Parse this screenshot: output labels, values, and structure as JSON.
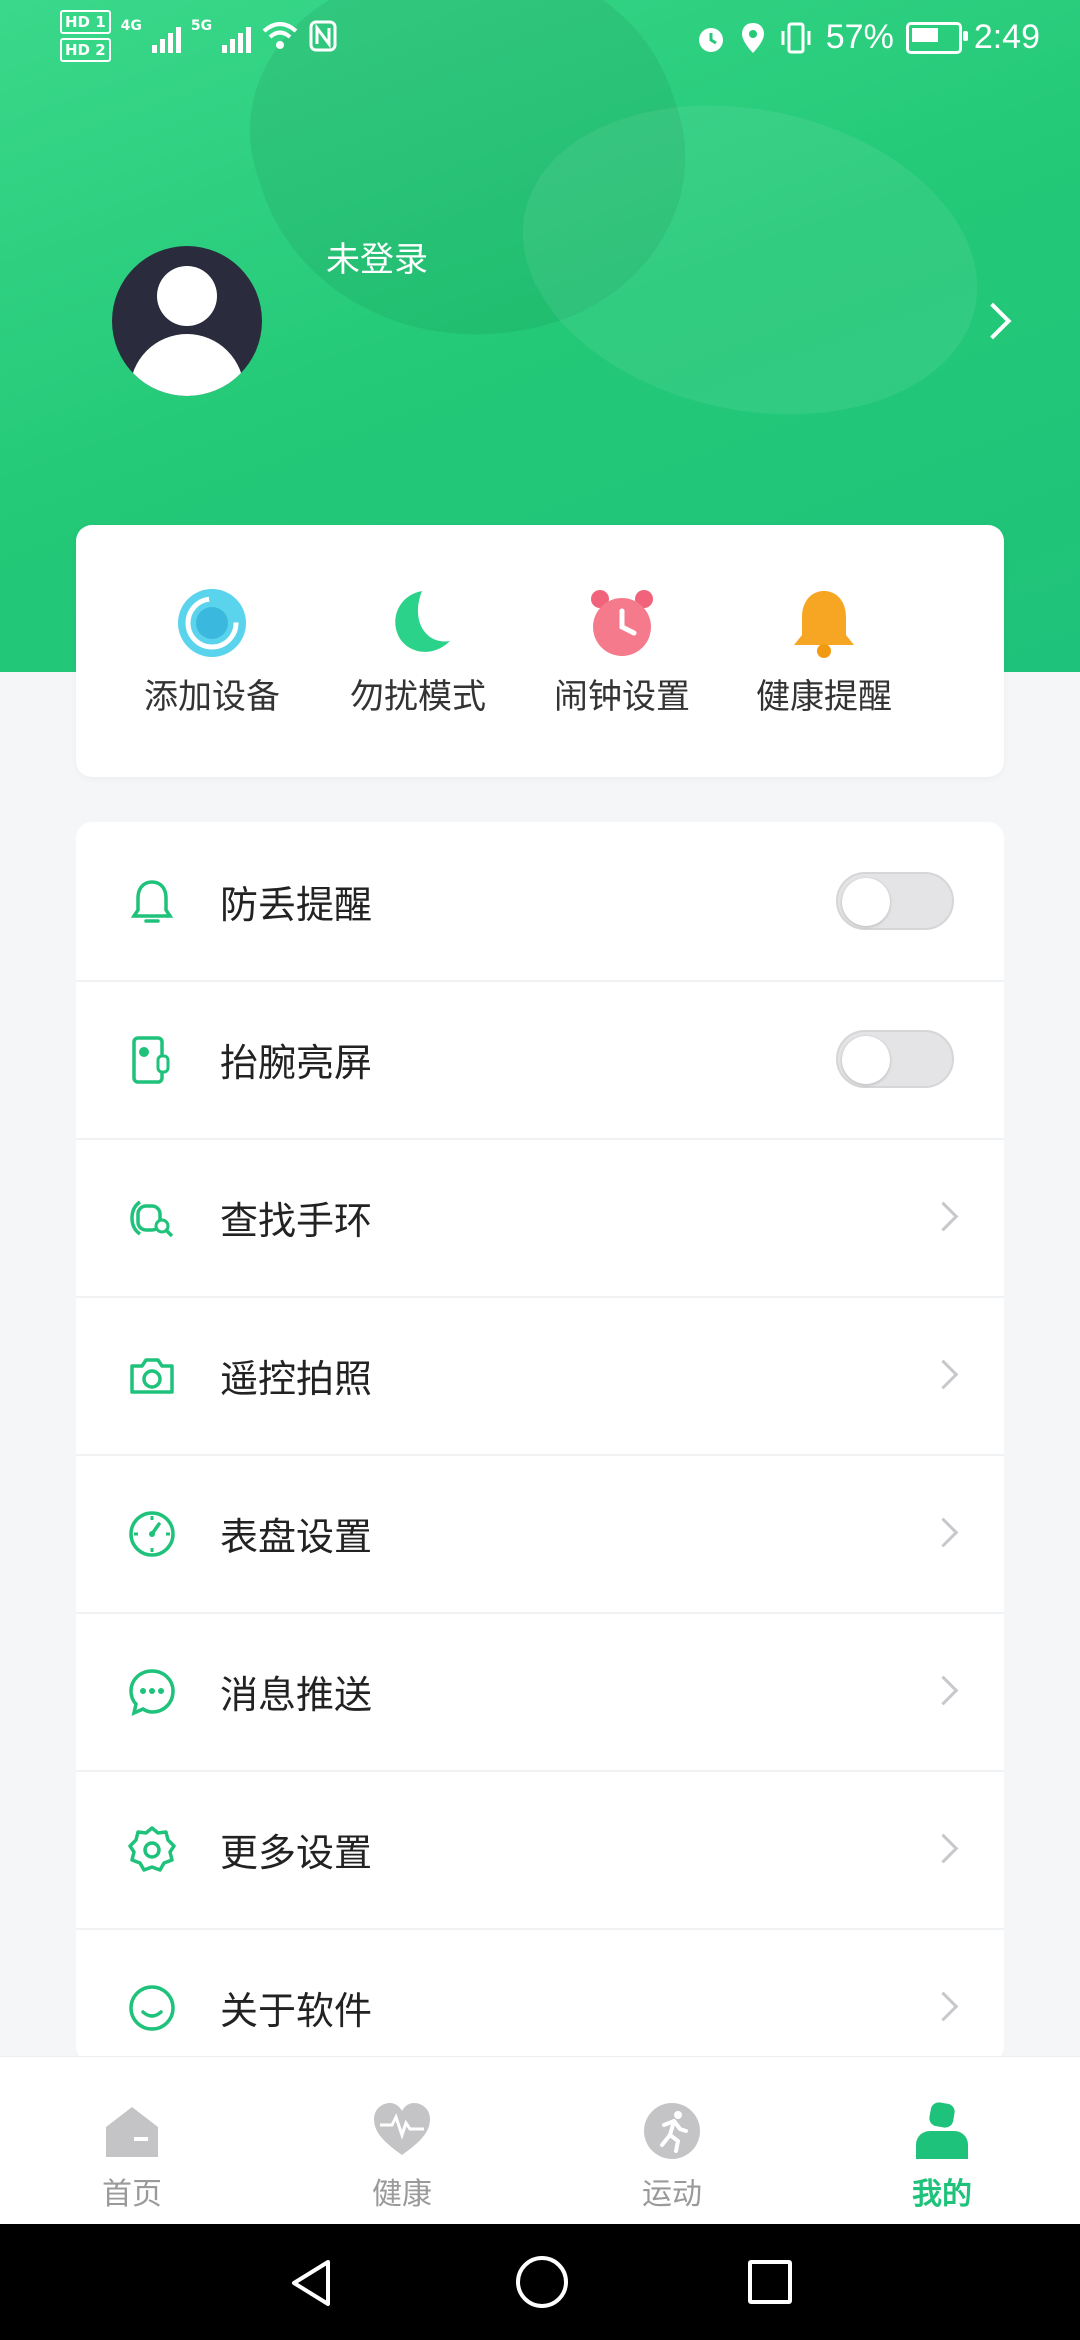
{
  "status_bar": {
    "sim1": "HD 1",
    "sim2": "HD 2",
    "net1": "4G",
    "net2": "5G",
    "battery": "57%",
    "time": "2:49"
  },
  "profile": {
    "login_text": "未登录"
  },
  "quick_actions": [
    {
      "label": "添加设备",
      "icon": "add-device-icon",
      "color": "#4cc8e6"
    },
    {
      "label": "勿扰模式",
      "icon": "moon-icon",
      "color": "#2bd38a"
    },
    {
      "label": "闹钟设置",
      "icon": "alarm-clock-icon",
      "color": "#f0637a"
    },
    {
      "label": "健康提醒",
      "icon": "bell-icon",
      "color": "#f7a623"
    }
  ],
  "settings": [
    {
      "label": "防丢提醒",
      "icon": "bell-outline-icon",
      "control": "toggle",
      "on": false
    },
    {
      "label": "抬腕亮屏",
      "icon": "raise-wrist-icon",
      "control": "toggle",
      "on": false
    },
    {
      "label": "查找手环",
      "icon": "find-band-icon",
      "control": "arrow"
    },
    {
      "label": "遥控拍照",
      "icon": "camera-icon",
      "control": "arrow"
    },
    {
      "label": "表盘设置",
      "icon": "dial-icon",
      "control": "arrow"
    },
    {
      "label": "消息推送",
      "icon": "message-icon",
      "control": "arrow"
    },
    {
      "label": "更多设置",
      "icon": "gear-icon",
      "control": "arrow"
    },
    {
      "label": "关于软件",
      "icon": "smile-icon",
      "control": "arrow"
    }
  ],
  "tabs": [
    {
      "label": "首页",
      "icon": "home-icon",
      "active": false
    },
    {
      "label": "健康",
      "icon": "heart-pulse-icon",
      "active": false
    },
    {
      "label": "运动",
      "icon": "running-icon",
      "active": false
    },
    {
      "label": "我的",
      "icon": "person-icon",
      "active": true
    }
  ],
  "colors": {
    "accent": "#1fc27a",
    "header_green": "#23c977",
    "inactive_tab": "#9a9a9a"
  }
}
